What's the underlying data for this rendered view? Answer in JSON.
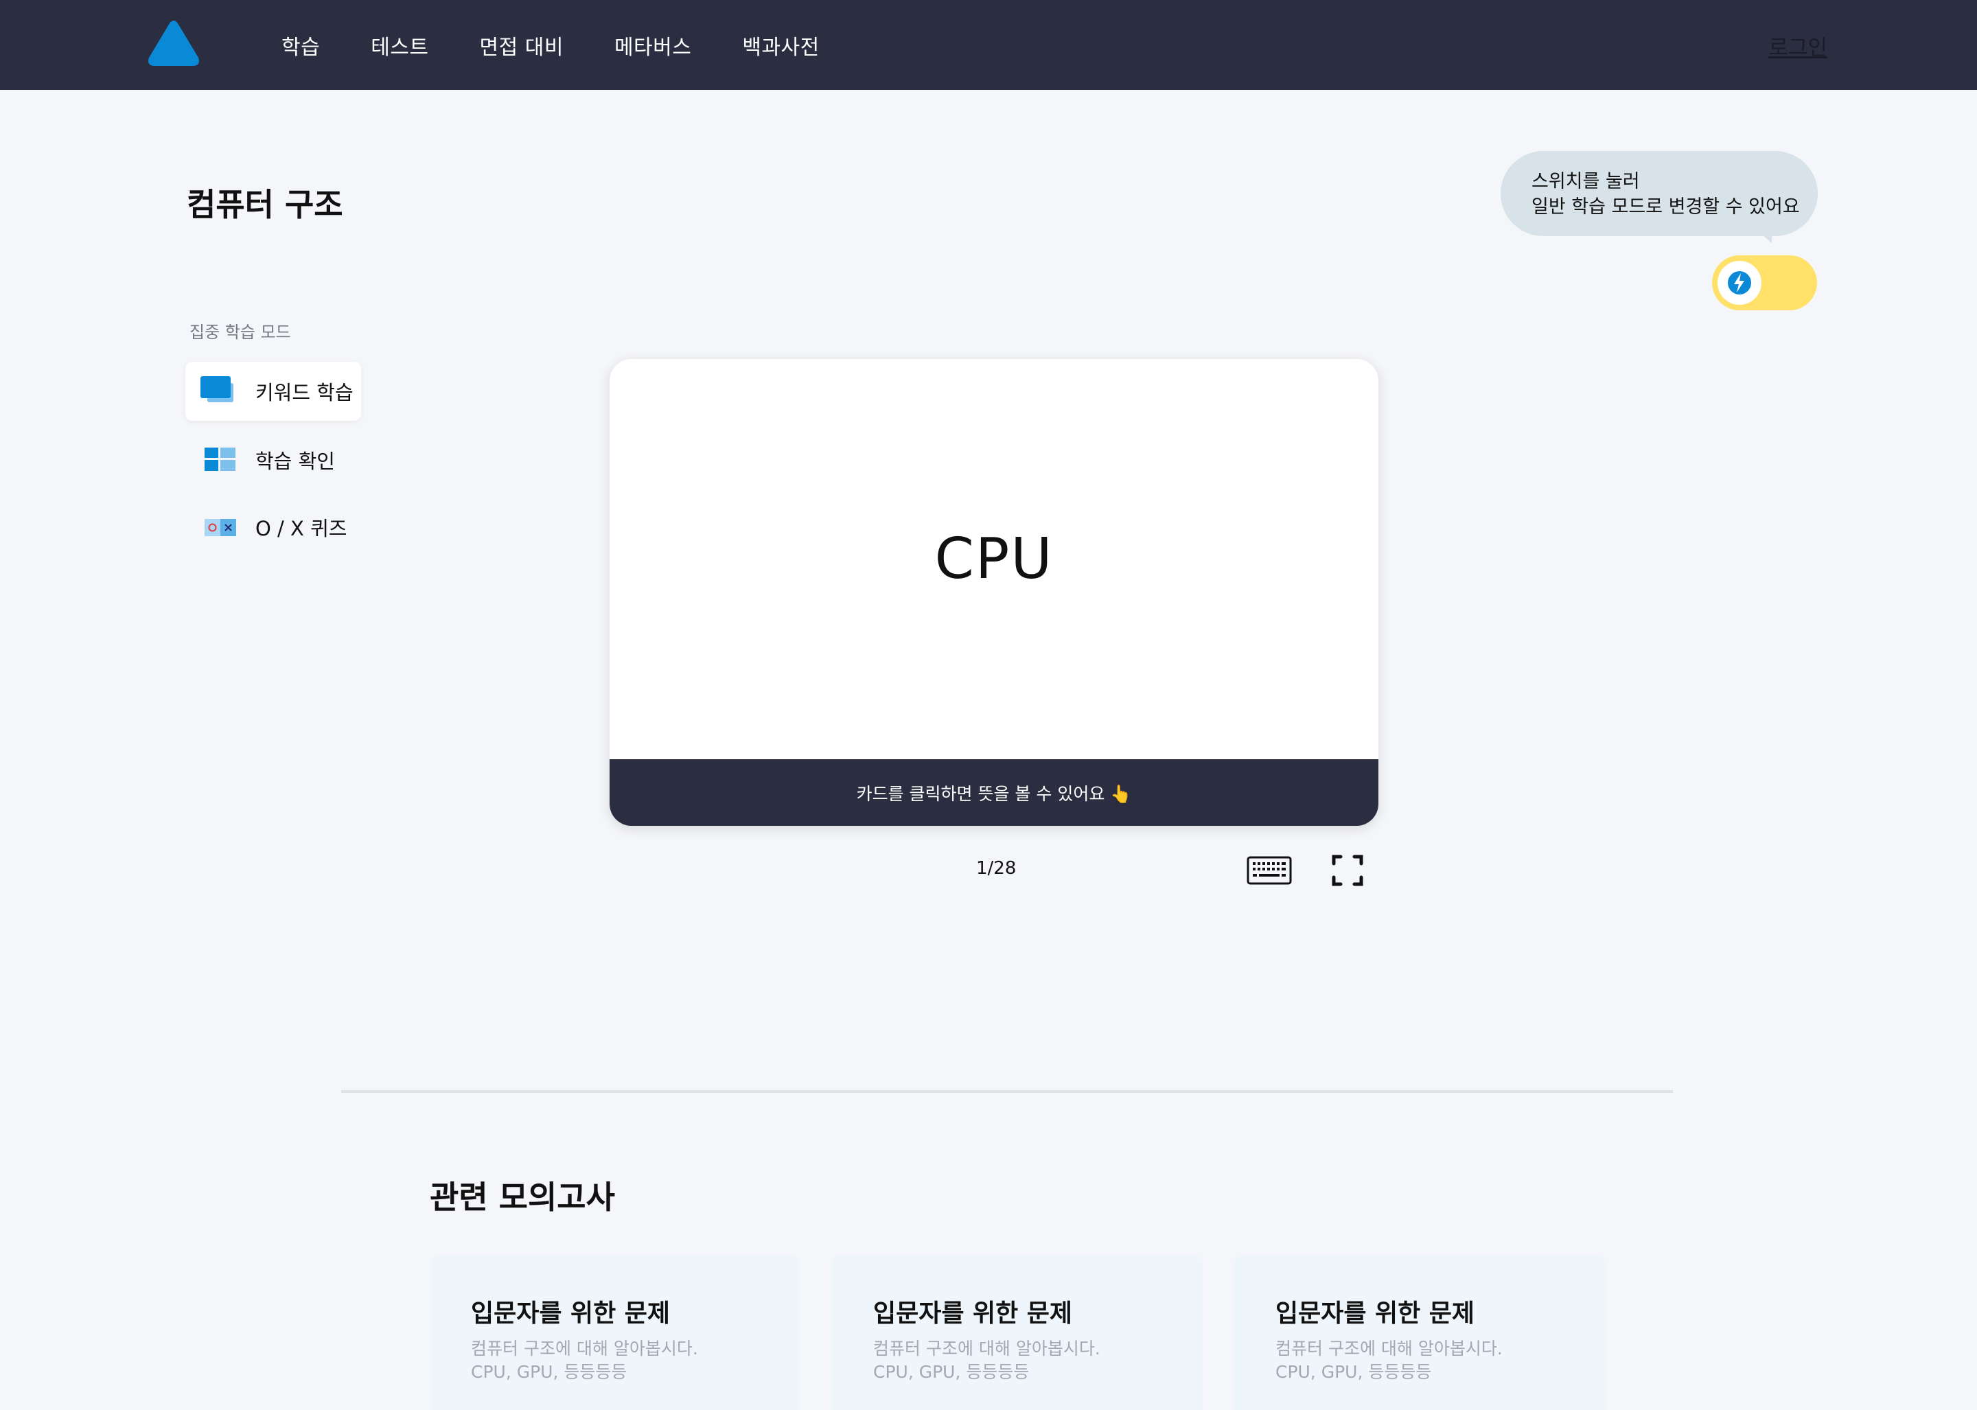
{
  "header": {
    "nav": [
      "학습",
      "테스트",
      "면접 대비",
      "메타버스",
      "백과사전"
    ],
    "login_label": "로그인",
    "brand_color": "#0a8ad6",
    "background": "#2b2d40"
  },
  "page": {
    "title": "컴퓨터 구조"
  },
  "bubble": {
    "line1": "스위치를 눌러",
    "line2": "일반 학습 모드로 변경할 수 있어요"
  },
  "toggle": {
    "icon": "lightning-icon",
    "color": "#ffe16a"
  },
  "sidebar": {
    "mode_label": "집중 학습 모드",
    "items": [
      {
        "label": "키워드 학습",
        "icon": "cards-icon",
        "active": true
      },
      {
        "label": "학습 확인",
        "icon": "grid-icon",
        "active": false
      },
      {
        "label": "O / X 퀴즈",
        "icon": "ox-quiz-icon",
        "active": false
      }
    ]
  },
  "card": {
    "word": "CPU",
    "hint": "카드를 클릭하면 뜻을 볼 수 있어요 👆"
  },
  "pager": {
    "counter": "1/28"
  },
  "related": {
    "title": "관련 모의고사",
    "exams": [
      {
        "title": "입문자를 위한 문제",
        "desc1": "컴퓨터 구조에 대해 알아봅시다.",
        "desc2": "CPU, GPU, 등등등등"
      },
      {
        "title": "입문자를 위한 문제",
        "desc1": "컴퓨터 구조에 대해 알아봅시다.",
        "desc2": "CPU, GPU, 등등등등"
      },
      {
        "title": "입문자를 위한 문제",
        "desc1": "컴퓨터 구조에 대해 알아봅시다.",
        "desc2": "CPU, GPU, 등등등등"
      }
    ]
  }
}
